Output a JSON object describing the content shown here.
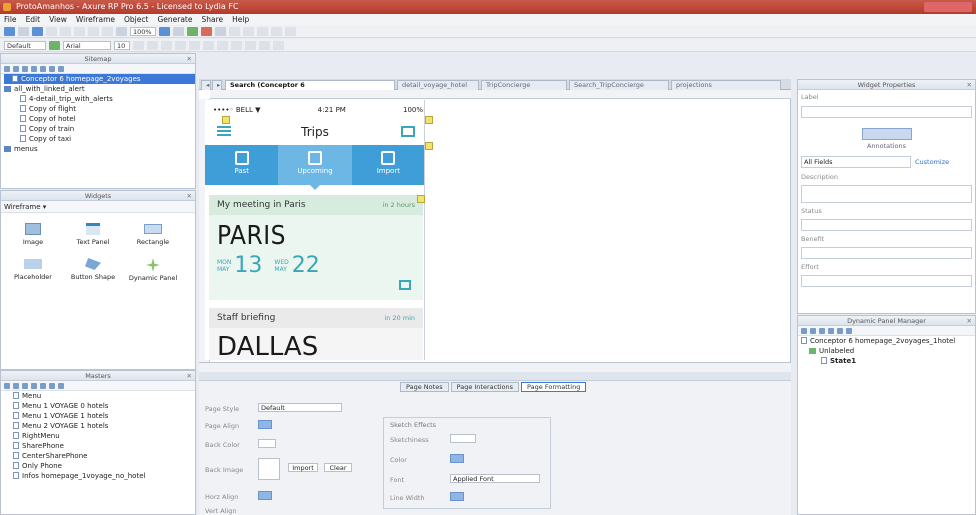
{
  "window": {
    "title": "ProtoAmanhos - Axure RP Pro 6.5 - Licensed to Lydia FC"
  },
  "menubar": [
    "File",
    "Edit",
    "View",
    "Wireframe",
    "Object",
    "Generate",
    "Share",
    "Help"
  ],
  "toolbar": {
    "style_select": "Default",
    "font_select": "Arial",
    "zoom": "100%",
    "font_size": "10"
  },
  "sitemap_panel": {
    "title": "Sitemap",
    "items": [
      {
        "label": "Conceptor 6 homepage_2voyages",
        "selected": true
      },
      {
        "label": "all_with_linked_alert"
      },
      {
        "label": "4-detail_trip_with_alerts"
      },
      {
        "label": "Copy of flight"
      },
      {
        "label": "Copy of hotel"
      },
      {
        "label": "Copy of train"
      },
      {
        "label": "Copy of taxi"
      },
      {
        "label": "menus"
      }
    ]
  },
  "widgets_panel": {
    "title": "Widgets",
    "library": "Wireframe",
    "widgets": [
      {
        "label": "Image"
      },
      {
        "label": "Text Panel"
      },
      {
        "label": "Rectangle"
      },
      {
        "label": "Placeholder"
      },
      {
        "label": "Button Shape"
      },
      {
        "label": "Dynamic Panel"
      }
    ]
  },
  "masters_panel": {
    "title": "Masters",
    "items": [
      "Menu",
      "Menu 1 VOYAGE 0 hotels",
      "Menu 1 VOYAGE 1 hotels",
      "Menu 2 VOYAGE 1 hotels",
      "RightMenu",
      "SharePhone",
      "CenterSharePhone",
      "Only Phone",
      "Infos homepage_1voyage_no_hotel"
    ]
  },
  "canvas_tabs": [
    {
      "label": "Search (Conceptor 6",
      "active": true
    },
    {
      "label": "detail_voyage_hotel"
    },
    {
      "label": "TripConcierge"
    },
    {
      "label": "Search_TripConcierge"
    },
    {
      "label": "projections"
    }
  ],
  "phone": {
    "status": {
      "carrier": "••••◦ BELL ▼",
      "time": "4:21 PM",
      "battery": "100%"
    },
    "nav_title": "Trips",
    "iconbar": [
      {
        "label": "Past",
        "active": false
      },
      {
        "label": "Upcoming",
        "active": true
      },
      {
        "label": "Import",
        "active": false
      }
    ],
    "card1": {
      "heading": "My meeting in Paris",
      "when": "in 2 hours",
      "city": "PARIS",
      "start": {
        "day": "MON",
        "month": "MAY",
        "date": "13"
      },
      "end": {
        "day": "WED",
        "month": "MAY",
        "date": "22"
      }
    },
    "card2": {
      "heading": "Staff briefing",
      "when": "in 20 min",
      "city": "DALLAS"
    }
  },
  "bottom_tabs": [
    {
      "label": "Page Notes"
    },
    {
      "label": "Page Interactions"
    },
    {
      "label": "Page Formatting",
      "active": true
    }
  ],
  "page_formatting": {
    "page_style_label": "Page Style",
    "page_style_value": "Default",
    "page_align_label": "Page Align",
    "back_color_label": "Back Color",
    "back_image_label": "Back Image",
    "import_label": "Import",
    "clear_label": "Clear",
    "horz_align_label": "Horz Align",
    "vert_align_label": "Vert Align",
    "sketch_label": "Sketch Effects",
    "sketchiness_label": "Sketchiness",
    "color_label": "Color",
    "font_label": "Font",
    "font_value": "Applied Font",
    "line_width_label": "Line Width"
  },
  "right_panel": {
    "title": "Widget Properties",
    "label_field": "Label",
    "annotations": "Annotations",
    "field_select": "All Fields",
    "customize": "Customize",
    "fields": [
      "Description",
      "Status",
      "Benefit",
      "Effort"
    ],
    "dynamic_title": "Dynamic Panel Manager",
    "dyn_items": [
      "Conceptor 6 homepage_2voyages_1hotel",
      "Unlabeled",
      "State1"
    ]
  }
}
